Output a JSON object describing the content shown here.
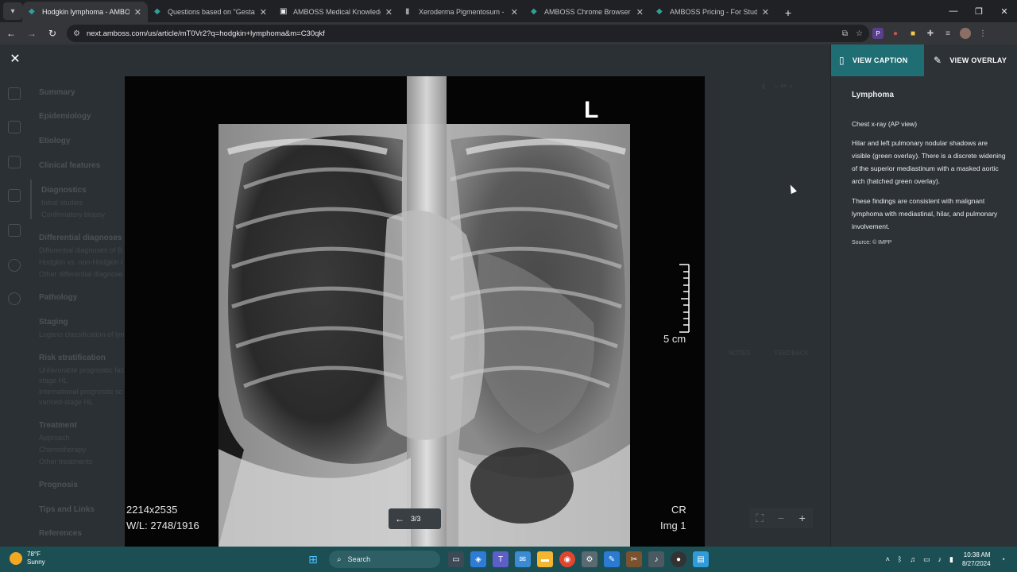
{
  "browser": {
    "tabs": [
      {
        "title": "Hodgkin lymphoma - AMBOSS",
        "active": true
      },
      {
        "title": "Questions based on \"Gestation",
        "active": false
      },
      {
        "title": "AMBOSS Medical Knowledge -",
        "active": false
      },
      {
        "title": "Xeroderma Pigmentosum - Sta",
        "active": false
      },
      {
        "title": "AMBOSS Chrome Browser Exte",
        "active": false
      },
      {
        "title": "AMBOSS Pricing - For Students",
        "active": false
      }
    ],
    "url": "next.amboss.com/us/article/mT0Vr2?q=hodgkin+lymphoma&m=C30qkf",
    "new_tab": "+",
    "ext_badge": "P"
  },
  "toc": {
    "sections": [
      {
        "label": "Summary"
      },
      {
        "label": "Epidemiology"
      },
      {
        "label": "Etiology"
      },
      {
        "label": "Clinical features"
      },
      {
        "label": "Diagnostics",
        "subs": [
          "Initial studies",
          "Confirmatory biopsy"
        ]
      },
      {
        "label": "Differential diagnoses",
        "subs": [
          "Differential diagnoses of B",
          "Hodgkin vs. non-Hodgkin l",
          "Other differential diagnose"
        ]
      },
      {
        "label": "Pathology"
      },
      {
        "label": "Staging",
        "subs": [
          "Lugano classification of lym"
        ]
      },
      {
        "label": "Risk stratification",
        "subs": [
          "Unfavorable prognostic fac",
          "stage HL",
          "International prognostic sc",
          "vanced-stage HL"
        ]
      },
      {
        "label": "Treatment",
        "subs": [
          "Approach",
          "Chemotherapy",
          "Other treatments"
        ]
      },
      {
        "label": "Prognosis"
      },
      {
        "label": "Tips and Links"
      },
      {
        "label": "References"
      }
    ]
  },
  "image": {
    "side_marker": "L",
    "scale_label": "5 cm",
    "dims": "2214x2535",
    "wl": "W/L: 2748/1916",
    "modality": "CR",
    "img_no": "Img 1",
    "pager": "3/3"
  },
  "behind": {
    "notes": "NOTES",
    "feedback": "FEEDBACK"
  },
  "caption": {
    "tab_caption": "VIEW CAPTION",
    "tab_overlay": "VIEW OVERLAY",
    "title": "Lymphoma",
    "subtitle": "Chest x-ray (AP view)",
    "para1": "Hilar and left pulmonary nodular shadows are visible (green overlay). There is a discrete widening of the superior mediastinum with a masked aortic arch (hatched green overlay).",
    "para2": "These findings are consistent with malignant lymphoma with mediastinal, hilar, and pulmonary involvement.",
    "source": "Source: © IMPP"
  },
  "taskbar": {
    "temp": "78°F",
    "weather": "Sunny",
    "search": "Search",
    "time": "10:38 AM",
    "date": "8/27/2024"
  }
}
